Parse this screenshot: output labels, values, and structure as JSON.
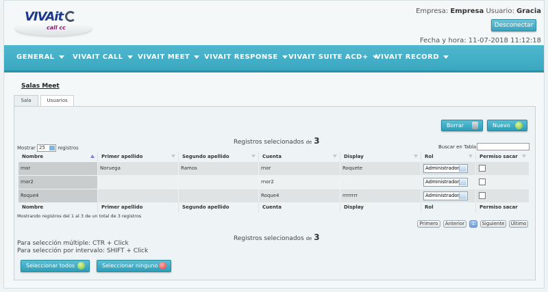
{
  "header": {
    "logo_text": "VIVAit",
    "logo_sub": "call cc",
    "empresa_label": "Empresa:",
    "empresa_value": "Empresa",
    "usuario_label": "Usuario:",
    "usuario_value": "Gracia",
    "disconnect_label": "Desconectar",
    "datetime_label": "Fecha y hora:",
    "datetime_value": "11-07-2018 11:12:18"
  },
  "nav": {
    "items": [
      "GENERAL",
      "VIVAIT CALL",
      "VIVAIT MEET",
      "VIVAIT RESPONSE",
      "VIVAIT SUITE ACD+",
      "VIVAIT RECORD"
    ]
  },
  "page": {
    "title": "Salas Meet",
    "tabs": [
      {
        "label": "Sala",
        "active": false
      },
      {
        "label": "Usuarios",
        "active": true
      }
    ]
  },
  "toolbar": {
    "delete_label": "Borrar",
    "new_label": "Nuevo"
  },
  "selection": {
    "label": "Registros selecionados",
    "de": "de",
    "count": "3"
  },
  "table": {
    "show_prefix": "Mostrar",
    "page_size": "25",
    "show_suffix": "registros",
    "search_label": "Buscar en Tabla:",
    "search_value": "",
    "columns": [
      "Nombre",
      "Primer apellido",
      "Segundo apellido",
      "Cuenta",
      "Display",
      "Rol",
      "Permiso sacar"
    ],
    "rows": [
      {
        "nombre": "rnor",
        "primer": "Noruega",
        "segundo": "Ramos",
        "cuenta": "rnor",
        "display": "Roquete",
        "rol": "Administrador",
        "permiso": false
      },
      {
        "nombre": "rnor2",
        "primer": "",
        "segundo": "",
        "cuenta": "rnor2",
        "display": "",
        "rol": "Administrador",
        "permiso": false
      },
      {
        "nombre": "Roque4",
        "primer": "",
        "segundo": "",
        "cuenta": "Roque4",
        "display": "rrrrrrrr",
        "rol": "Administrador",
        "permiso": false
      }
    ],
    "info": "Mostrando registros del 1 al 3 de un total de 3 registros"
  },
  "pagination": {
    "first": "Primero",
    "prev": "Anterior",
    "current": "1",
    "next": "Siguiente",
    "last": "Último"
  },
  "help": {
    "multiple": "Para selección múltiple: CTR + Click",
    "interval": "Para selección por intervalo: SHIFT + Click"
  },
  "actions": {
    "select_all": "Seleccionar todos",
    "select_none": "Seleccionar ninguno"
  },
  "colors": {
    "nav": "#3ea9c2",
    "button": "#3aa3bd",
    "brand": "#1b3a8c"
  }
}
